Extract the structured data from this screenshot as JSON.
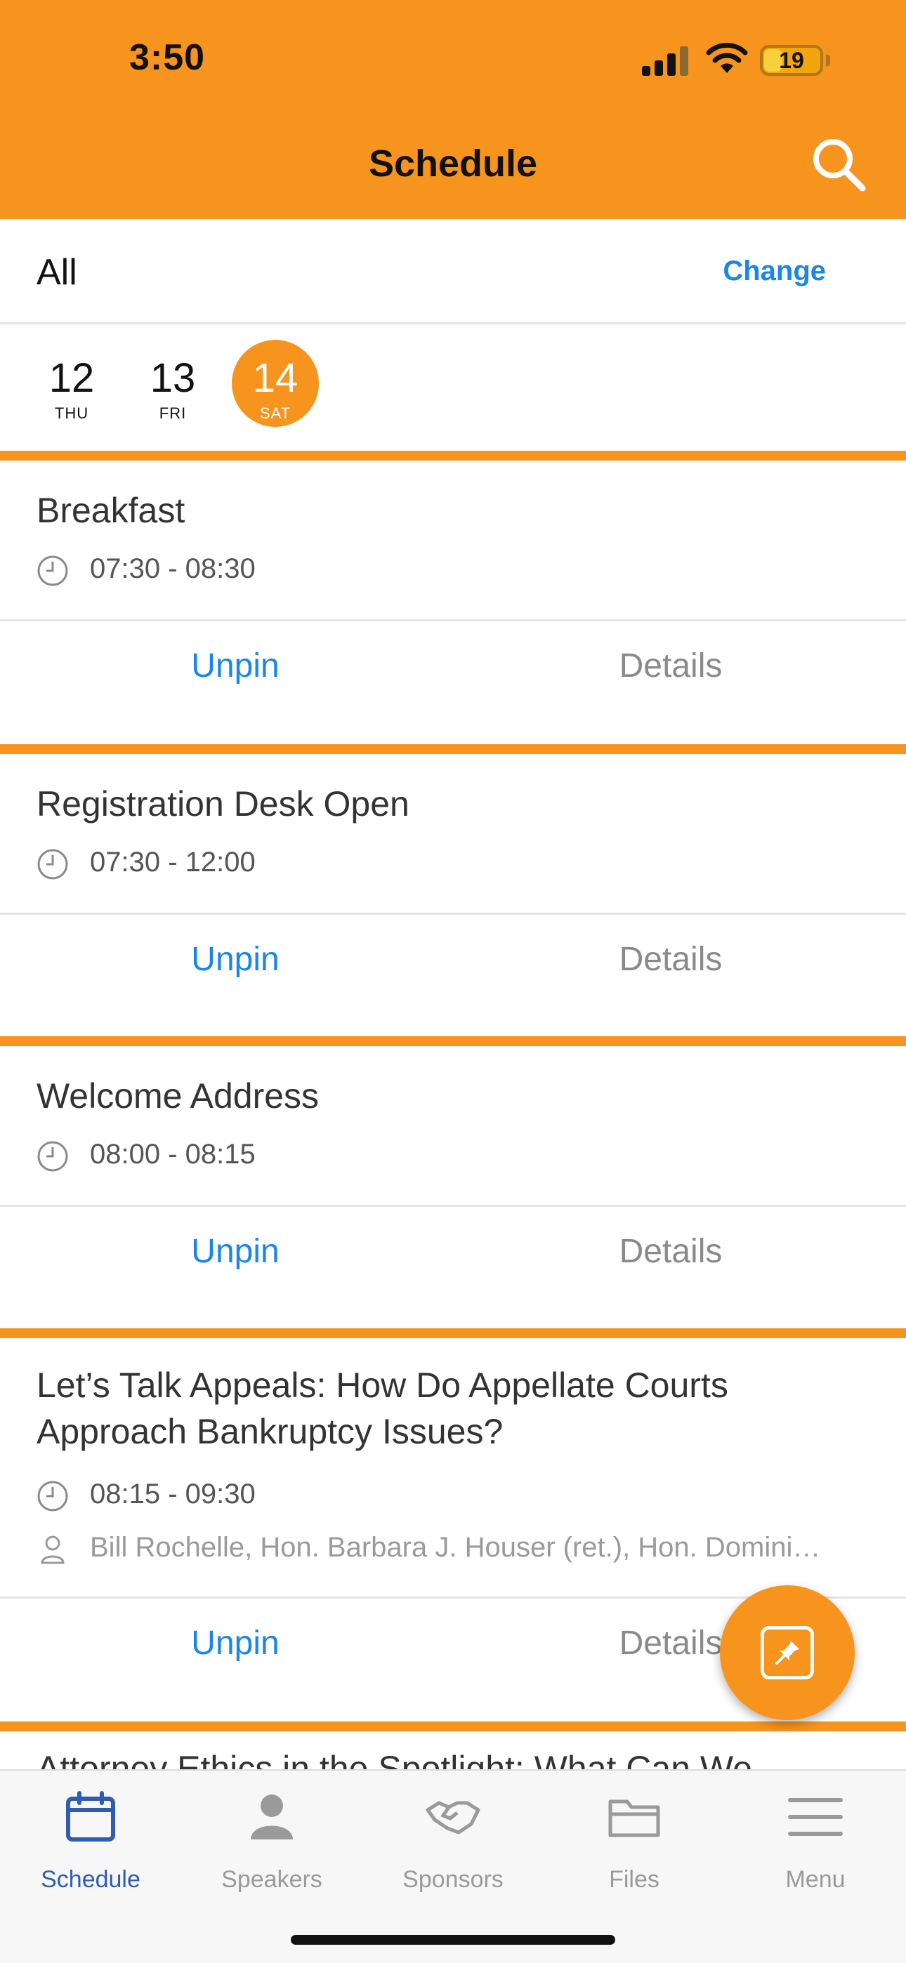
{
  "status": {
    "time": "3:50",
    "battery": "19"
  },
  "header": {
    "title": "Schedule"
  },
  "filter": {
    "label": "All",
    "change": "Change"
  },
  "dates": [
    {
      "num": "12",
      "dow": "THU"
    },
    {
      "num": "13",
      "dow": "FRI"
    },
    {
      "num": "14",
      "dow": "SAT"
    }
  ],
  "sessions": [
    {
      "title": "Breakfast",
      "time": "07:30 - 08:30",
      "unpin": "Unpin",
      "details": "Details"
    },
    {
      "title": "Registration Desk Open",
      "time": "07:30 - 12:00",
      "unpin": "Unpin",
      "details": "Details"
    },
    {
      "title": "Welcome Address",
      "time": "08:00 - 08:15",
      "unpin": "Unpin",
      "details": "Details"
    },
    {
      "title_line1": "Let’s Talk Appeals: How Do Appellate Courts",
      "title_line2": "Approach Bankruptcy Issues?",
      "time": "08:15 - 09:30",
      "speakers": "Bill Rochelle, Hon. Barbara J. Houser (ret.), Hon. Domini…",
      "unpin": "Unpin",
      "details": "Details"
    },
    {
      "title": "Attorney Ethics in the Spotlight: What Can We"
    }
  ],
  "tabs": [
    {
      "label": "Schedule",
      "icon": "calendar-icon"
    },
    {
      "label": "Speakers",
      "icon": "person-icon"
    },
    {
      "label": "Sponsors",
      "icon": "handshake-icon"
    },
    {
      "label": "Files",
      "icon": "folder-icon"
    },
    {
      "label": "Menu",
      "icon": "menu-icon"
    }
  ],
  "colors": {
    "accent": "#f7941d",
    "link": "#1a86e8",
    "tab_active": "#2f5bb3"
  }
}
